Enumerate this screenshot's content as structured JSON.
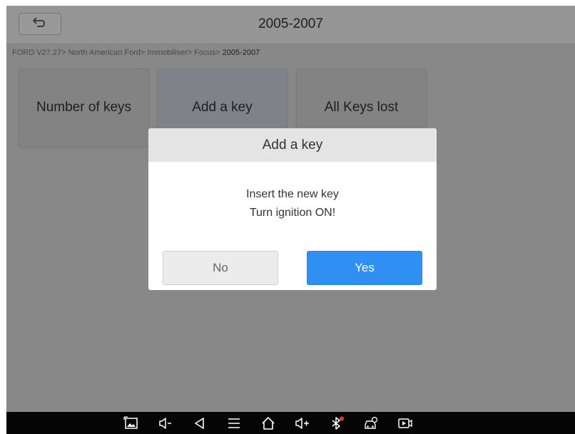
{
  "header": {
    "title": "2005-2007",
    "back_icon": "back-arrow-icon"
  },
  "breadcrumb": {
    "path": "FORD V27.27> North American Ford> Immobiliser> Focus> ",
    "current": "2005-2007"
  },
  "tiles": [
    {
      "label": "Number of keys"
    },
    {
      "label": "Add a key"
    },
    {
      "label": "All Keys lost"
    }
  ],
  "dialog": {
    "title": "Add a key",
    "line1": "Insert the new key",
    "line2": "Turn ignition ON!",
    "no_label": "No",
    "yes_label": "Yes"
  },
  "colors": {
    "accent": "#2f8ff2",
    "navbar": "#050505",
    "bluetooth_dot": "#e53935"
  },
  "navbar": {
    "icons": [
      "screenshot-icon",
      "volume-down-icon",
      "back-icon",
      "menu-icon",
      "home-icon",
      "volume-up-icon",
      "bluetooth-icon",
      "vci-car-icon",
      "screen-record-icon"
    ]
  }
}
